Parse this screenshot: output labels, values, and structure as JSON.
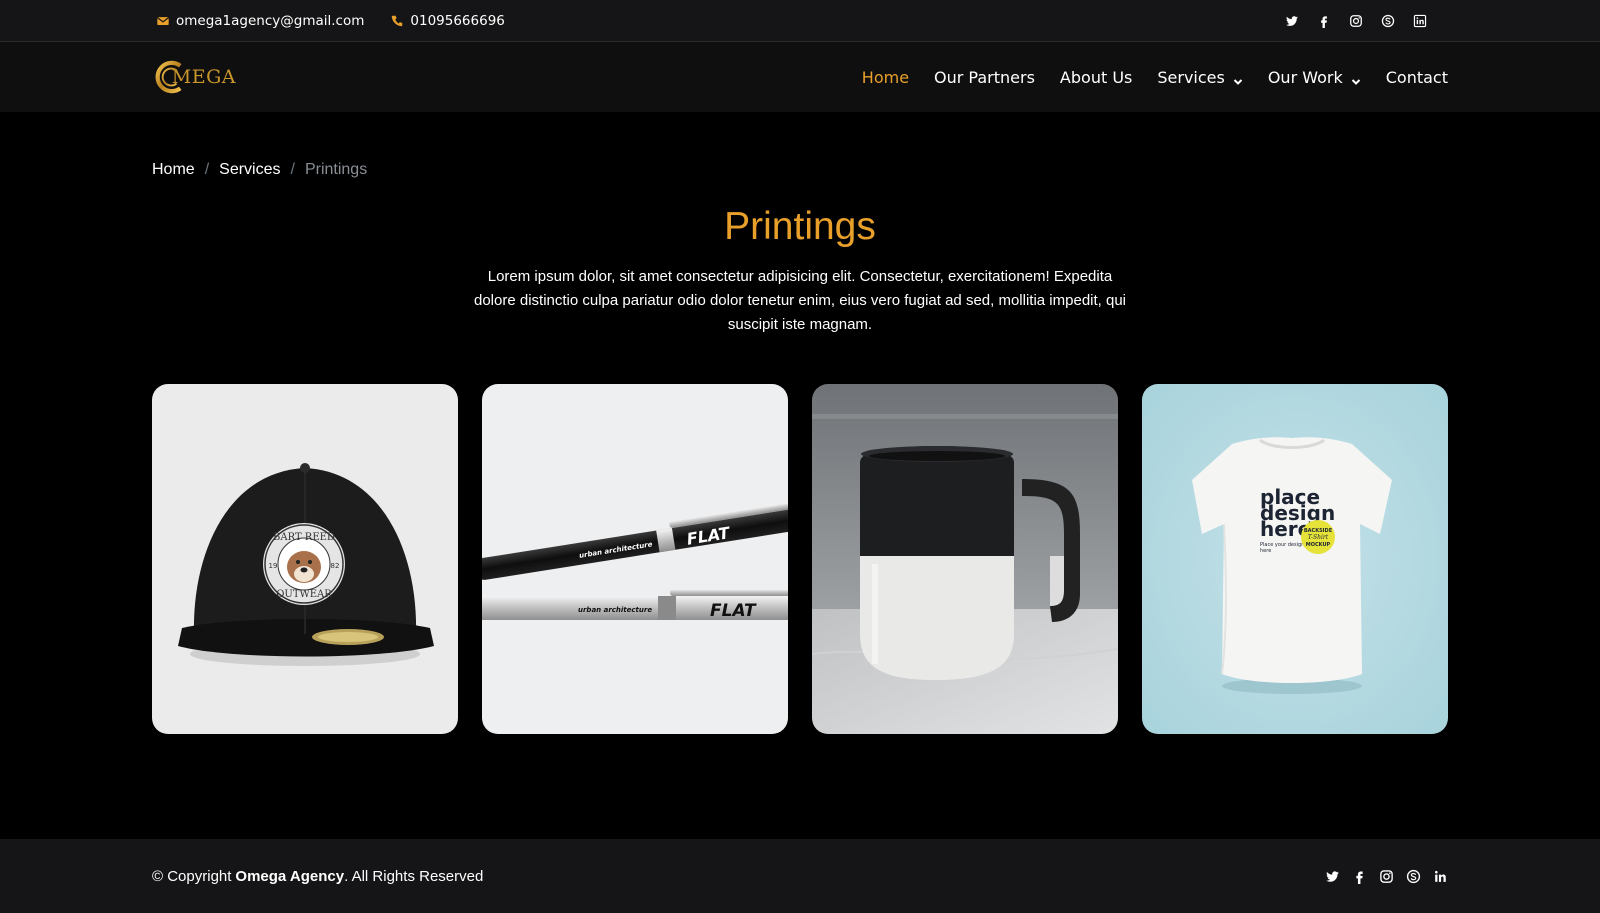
{
  "topbar": {
    "email": "omega1agency@gmail.com",
    "phone": "01095666696",
    "icons": [
      "mail-icon",
      "phone-icon"
    ],
    "social": [
      "twitter-icon",
      "facebook-icon",
      "instagram-icon",
      "skype-icon",
      "linkedin-icon"
    ]
  },
  "header": {
    "logo_text": "MEGA",
    "nav": [
      {
        "label": "Home",
        "active": true
      },
      {
        "label": "Our Partners"
      },
      {
        "label": "About Us"
      },
      {
        "label": "Services",
        "dropdown": true
      },
      {
        "label": "Our Work",
        "dropdown": true
      },
      {
        "label": "Contact"
      }
    ]
  },
  "breadcrumb": {
    "items": [
      "Home",
      "Services"
    ],
    "separator": "/",
    "current": "Printings"
  },
  "main": {
    "title": "Printings",
    "description": "Lorem ipsum dolor, sit amet consectetur adipisicing elit. Consectetur, exercitationem! Expedita dolore distinctio culpa pariatur odio dolor tenetur enim, eius vero fugiat ad sed, mollitia impedit, qui suscipit iste magnam."
  },
  "cards": [
    {
      "name": "cap",
      "patch_top": "BART REED",
      "patch_bottom": "OUTWEAR",
      "left_num": "19",
      "right_num": "82"
    },
    {
      "name": "pens",
      "brand": "FLAT",
      "brand_mark": "F",
      "tagline": "urban architecture"
    },
    {
      "name": "mug"
    },
    {
      "name": "tshirt",
      "headline_1": "place",
      "headline_2": "design",
      "headline_3": "here",
      "small_1": "Place your design",
      "small_2": "here",
      "badge_1": "BACKSIDE",
      "badge_2": "T-Shirt",
      "badge_3": "MOCKUP"
    }
  ],
  "footer": {
    "copyright_prefix": "© Copyright",
    "brand": "Omega Agency",
    "copyright_suffix": ". All Rights Reserved",
    "social": [
      "twitter-icon",
      "facebook-icon",
      "instagram-icon",
      "skype-icon",
      "linkedin-icon"
    ]
  },
  "colors": {
    "accent": "#e8a02b",
    "background": "#000000",
    "topbar": "#151517",
    "header": "#0f0f10"
  }
}
